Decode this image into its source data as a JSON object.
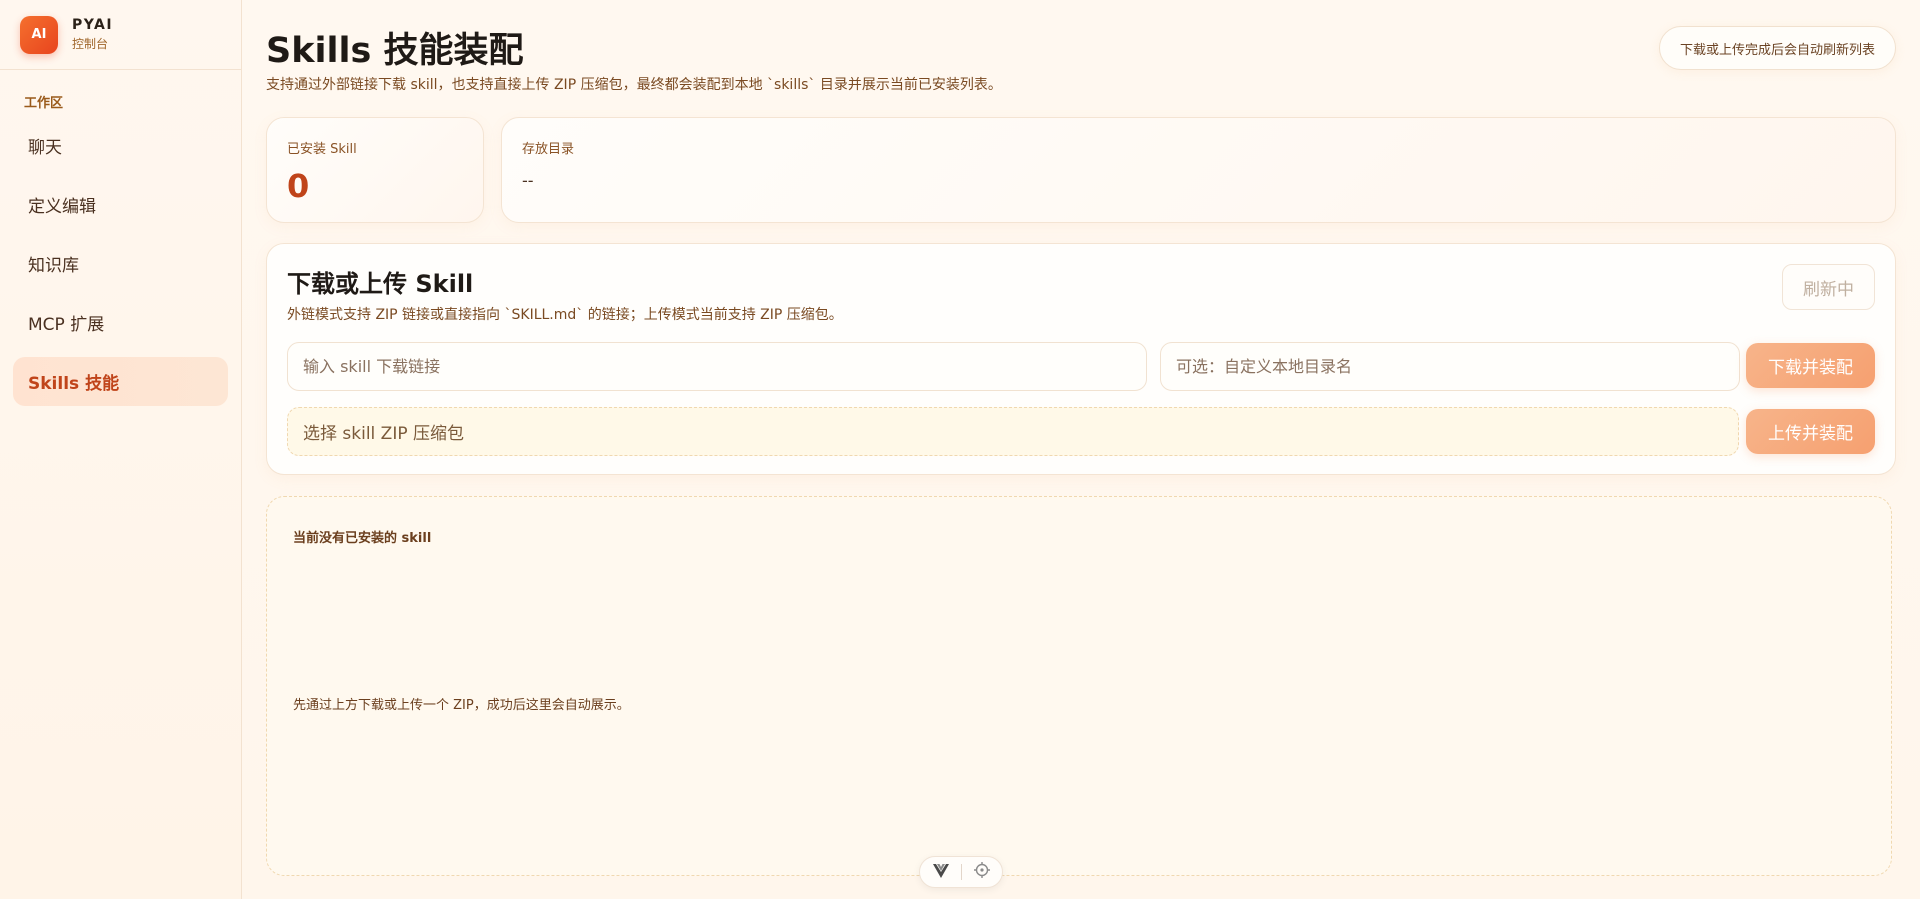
{
  "brand": {
    "logo_text": "AI",
    "title": "PYAI",
    "subtitle": "控制台"
  },
  "sidebar": {
    "section_label": "工作区",
    "items": [
      {
        "label": "聊天"
      },
      {
        "label": "定义编辑"
      },
      {
        "label": "知识库"
      },
      {
        "label": "MCP 扩展"
      },
      {
        "label": "Skills 技能",
        "active": true
      }
    ]
  },
  "header": {
    "title": "Skills 技能装配",
    "description": "支持通过外部链接下载 skill，也支持直接上传 ZIP 压缩包，最终都会装配到本地 `skills` 目录并展示当前已安装列表。",
    "hint": "下载或上传完成后会自动刷新列表"
  },
  "stats": {
    "installed_label": "已安装 Skill",
    "installed_count": "0",
    "directory_label": "存放目录",
    "directory_value": "--"
  },
  "upload": {
    "title": "下载或上传 Skill",
    "description": "外链模式支持 ZIP 链接或直接指向 `SKILL.md` 的链接；上传模式当前支持 ZIP 压缩包。",
    "refresh_label": "刷新中",
    "url_placeholder": "输入 skill 下载链接",
    "dirname_placeholder": "可选：自定义本地目录名",
    "download_button": "下载并装配",
    "file_label": "选择 skill ZIP 压缩包",
    "upload_button": "上传并装配"
  },
  "empty": {
    "title": "当前没有已安装的 skill",
    "description": "先通过上方下载或上传一个 ZIP，成功后这里会自动展示。"
  },
  "colors": {
    "accent": "#c0441a",
    "primary_button": "#f6a070",
    "logo": "#e8441e"
  }
}
